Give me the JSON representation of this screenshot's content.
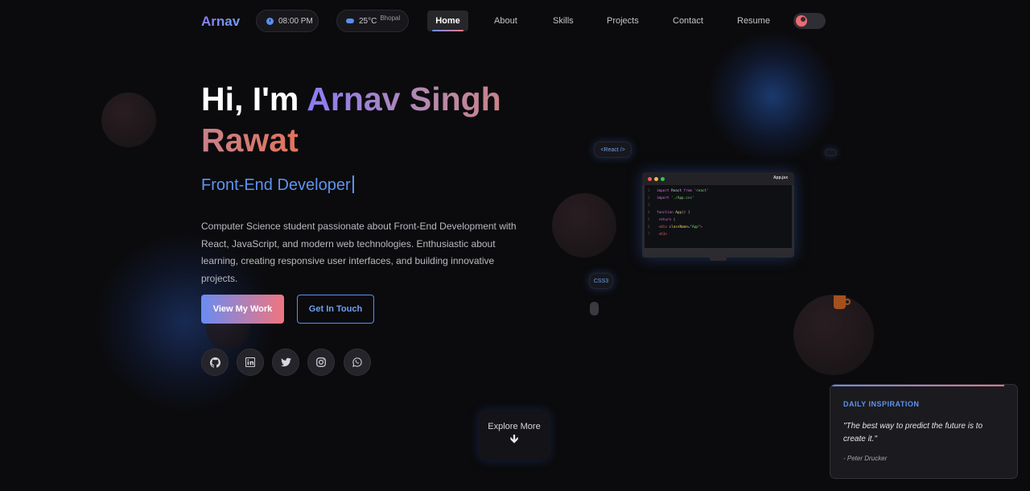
{
  "nav": {
    "logo": "Arnav",
    "time": "08:00 PM",
    "weather_temp": "25°C",
    "weather_city": "Bhopal",
    "links": [
      "Home",
      "About",
      "Skills",
      "Projects",
      "Contact",
      "Resume"
    ],
    "active_link": "Home"
  },
  "hero": {
    "greeting": "Hi, I'm ",
    "name": "Arnav Singh Rawat",
    "role": "Front-End Developer",
    "description": "Computer Science student passionate about Front-End Development with React, JavaScript, and modern web technologies. Enthusiastic about learning, creating responsive user interfaces, and building innovative projects.",
    "primary_button": "View My Work",
    "secondary_button": "Get In Touch",
    "socials": [
      "github-icon",
      "linkedin-icon",
      "twitter-icon",
      "instagram-icon",
      "whatsapp-icon"
    ]
  },
  "floating": {
    "react_tag": "<React />",
    "css_tag": "CSS3"
  },
  "laptop": {
    "file_name": "App.jsx",
    "code_lines": [
      {
        "n": "1",
        "parts": [
          {
            "c": "kw",
            "t": "import "
          },
          {
            "c": "",
            "t": "React "
          },
          {
            "c": "kw",
            "t": "from "
          },
          {
            "c": "str",
            "t": "'react'"
          }
        ]
      },
      {
        "n": "2",
        "parts": [
          {
            "c": "kw",
            "t": "import "
          },
          {
            "c": "str",
            "t": "'./App.css'"
          }
        ]
      },
      {
        "n": "3",
        "parts": []
      },
      {
        "n": "4",
        "parts": [
          {
            "c": "kw",
            "t": "function "
          },
          {
            "c": "fn",
            "t": "App"
          },
          {
            "c": "",
            "t": "() {"
          }
        ]
      },
      {
        "n": "5",
        "parts": [
          {
            "c": "kw",
            "t": "  return "
          },
          {
            "c": "",
            "t": "("
          }
        ]
      },
      {
        "n": "6",
        "parts": [
          {
            "c": "tg",
            "t": "    <div "
          },
          {
            "c": "fn",
            "t": "className"
          },
          {
            "c": "",
            "t": "="
          },
          {
            "c": "str",
            "t": "\"App\""
          },
          {
            "c": "tg",
            "t": ">"
          }
        ]
      },
      {
        "n": "7",
        "parts": [
          {
            "c": "tg",
            "t": "      <h1>"
          }
        ]
      }
    ]
  },
  "explore": {
    "label": "Explore More"
  },
  "quote": {
    "heading": "DAILY INSPIRATION",
    "text": "\"The best way to predict the future is to create it.\"",
    "author": "- Peter Drucker"
  },
  "colors": {
    "background": "#0b0b0d",
    "accent_blue": "#5f93ef",
    "accent_purple": "#8b7cf6",
    "accent_coral": "#f0757f"
  }
}
